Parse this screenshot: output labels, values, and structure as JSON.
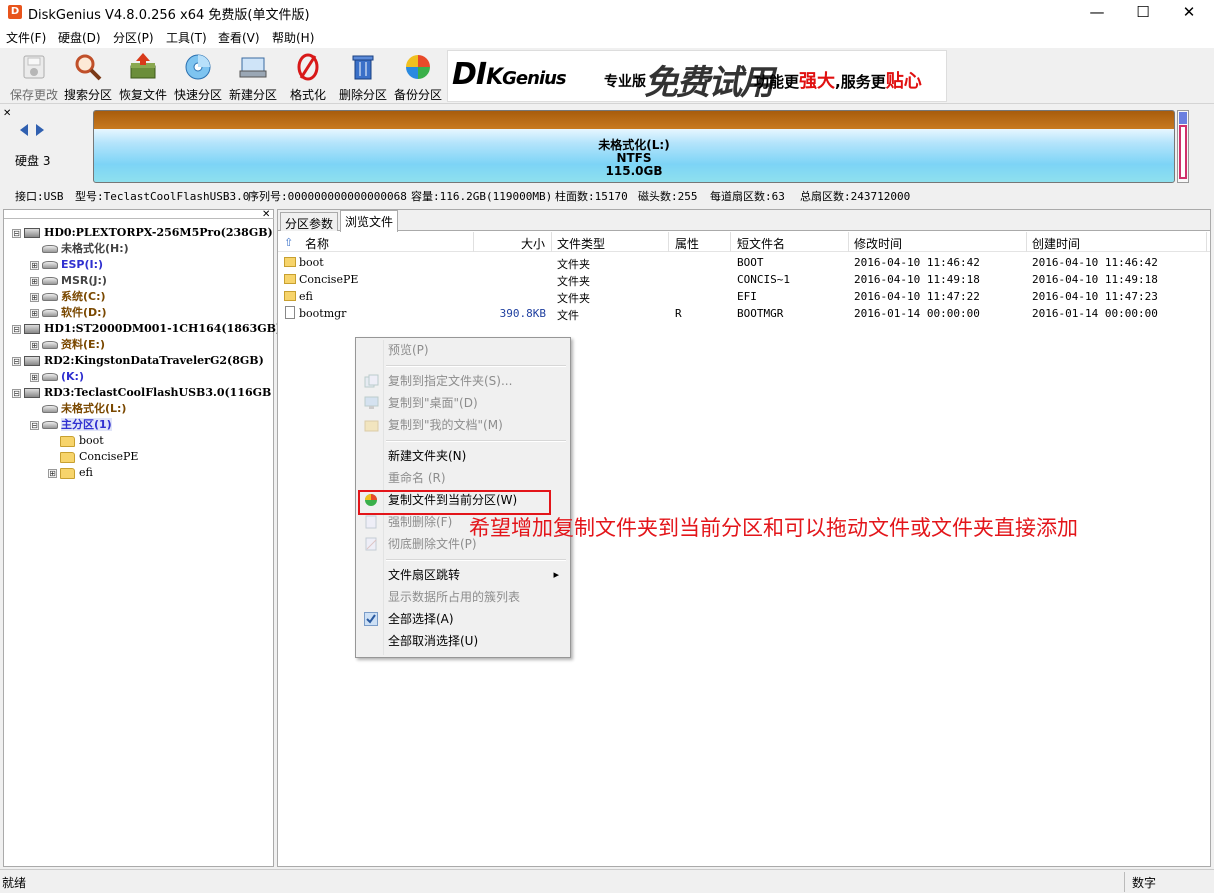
{
  "window": {
    "title": "DiskGenius V4.8.0.256 x64 免费版(单文件版)",
    "minimize": "—",
    "maximize": "☐",
    "close": "✕",
    "app_icon": "D"
  },
  "menu": [
    "文件(F)",
    "硬盘(D)",
    "分区(P)",
    "工具(T)",
    "查看(V)",
    "帮助(H)"
  ],
  "toolbar": [
    {
      "label": "保存更改",
      "icon": "save-icon",
      "disabled": true
    },
    {
      "label": "搜索分区",
      "icon": "search-partition-icon",
      "disabled": false
    },
    {
      "label": "恢复文件",
      "icon": "recover-files-icon",
      "disabled": false
    },
    {
      "label": "快速分区",
      "icon": "quick-partition-icon",
      "disabled": false
    },
    {
      "label": "新建分区",
      "icon": "new-partition-icon",
      "disabled": false
    },
    {
      "label": "格式化",
      "icon": "format-icon",
      "disabled": false
    },
    {
      "label": "删除分区",
      "icon": "delete-partition-icon",
      "disabled": false
    },
    {
      "label": "备份分区",
      "icon": "backup-partition-icon",
      "disabled": false
    }
  ],
  "banner": {
    "logo_d": "DI",
    "logo_k": "K",
    "logo_rest": "Genius",
    "edition": "专业版",
    "trial": "免费试用",
    "slogan_a": "功能更",
    "slogan_b": "强大",
    "slogan_c": ",服务更",
    "slogan_d": "贴心"
  },
  "disk_map": {
    "disk_label": "硬盘 3",
    "partition_name": "未格式化(L:)",
    "partition_fs": "NTFS",
    "partition_size": "115.0GB"
  },
  "disk_info": {
    "interface": "接口:USB",
    "model": "型号:TeclastCoolFlashUSB3.0",
    "serial": "序列号:000000000000000068",
    "capacity": "容量:116.2GB(119000MB)",
    "cylinders": "柱面数:15170",
    "heads": "磁头数:255",
    "sectors_per_track": "每道扇区数:63",
    "total_sectors": "总扇区数:243712000"
  },
  "tree": [
    {
      "text": "HD0:PLEXTORPX-256M5Pro(238GB)",
      "type": "disk",
      "expander": "⊟"
    },
    {
      "text": "未格式化(H:)",
      "type": "partition",
      "style": "p-gray",
      "expander": ""
    },
    {
      "text": "ESP(I:)",
      "type": "partition",
      "style": "p-blue",
      "expander": "⊞"
    },
    {
      "text": "MSR(J:)",
      "type": "partition",
      "style": "p-gray",
      "expander": "⊞"
    },
    {
      "text": "系统(C:)",
      "type": "partition",
      "style": "p-brown",
      "expander": "⊞"
    },
    {
      "text": "软件(D:)",
      "type": "partition",
      "style": "p-brown",
      "expander": "⊞"
    },
    {
      "text": "HD1:ST2000DM001-1CH164(1863GB)",
      "type": "disk",
      "expander": "⊟"
    },
    {
      "text": "资料(E:)",
      "type": "partition",
      "style": "p-brown",
      "expander": "⊞"
    },
    {
      "text": "RD2:KingstonDataTravelerG2(8GB)",
      "type": "disk",
      "expander": "⊟"
    },
    {
      "text": "(K:)",
      "type": "partition",
      "style": "p-blue",
      "expander": "⊞"
    },
    {
      "text": "RD3:TeclastCoolFlashUSB3.0(116GB",
      "type": "disk",
      "expander": "⊟"
    },
    {
      "text": "未格式化(L:)",
      "type": "partition",
      "style": "p-brown",
      "expander": ""
    },
    {
      "text": "主分区(1)",
      "type": "partition",
      "style": "p-blue",
      "expander": "⊟"
    },
    {
      "text": "boot",
      "type": "folder",
      "expander": ""
    },
    {
      "text": "ConcisePE",
      "type": "folder",
      "expander": ""
    },
    {
      "text": "efi",
      "type": "folder",
      "expander": "⊞"
    }
  ],
  "tabs": [
    "分区参数",
    "浏览文件"
  ],
  "columns": [
    "名称",
    "大小",
    "文件类型",
    "属性",
    "短文件名",
    "修改时间",
    "创建时间"
  ],
  "files": [
    {
      "name": "boot",
      "size": "",
      "type": "文件夹",
      "attr": "",
      "short": "BOOT",
      "modified": "2016-04-10 11:46:42",
      "created": "2016-04-10 11:46:42",
      "kind": "folder"
    },
    {
      "name": "ConcisePE",
      "size": "",
      "type": "文件夹",
      "attr": "",
      "short": "CONCIS~1",
      "modified": "2016-04-10 11:49:18",
      "created": "2016-04-10 11:49:18",
      "kind": "folder"
    },
    {
      "name": "efi",
      "size": "",
      "type": "文件夹",
      "attr": "",
      "short": "EFI",
      "modified": "2016-04-10 11:47:22",
      "created": "2016-04-10 11:47:23",
      "kind": "folder"
    },
    {
      "name": "bootmgr",
      "size": "390.8KB",
      "type": "文件",
      "attr": "R",
      "short": "BOOTMGR",
      "modified": "2016-01-14 00:00:00",
      "created": "2016-01-14 00:00:00",
      "kind": "file"
    }
  ],
  "context_menu": [
    {
      "label": "预览(P)",
      "disabled": true
    },
    {
      "sep": true
    },
    {
      "label": "复制到指定文件夹(S)...",
      "disabled": true,
      "icon": "copy-icon"
    },
    {
      "label": "复制到\"桌面\"(D)",
      "disabled": true,
      "icon": "desktop-icon"
    },
    {
      "label": "复制到\"我的文档\"(M)",
      "disabled": true,
      "icon": "documents-icon"
    },
    {
      "sep": true
    },
    {
      "label": "新建文件夹(N)",
      "disabled": false
    },
    {
      "label": "重命名 (R)",
      "disabled": true
    },
    {
      "label": "复制文件到当前分区(W)",
      "disabled": false,
      "icon": "partition-pie-icon"
    },
    {
      "label": "强制删除(F)",
      "disabled": true,
      "icon": "delete-file-icon"
    },
    {
      "label": "彻底删除文件(P)",
      "disabled": true,
      "icon": "erase-icon"
    },
    {
      "sep": true
    },
    {
      "label": "文件扇区跳转",
      "disabled": false,
      "submenu": true
    },
    {
      "label": "显示数据所占用的簇列表",
      "disabled": true
    },
    {
      "label": "全部选择(A)",
      "disabled": false,
      "icon": "check-icon"
    },
    {
      "label": "全部取消选择(U)",
      "disabled": false
    }
  ],
  "annotation": "希望增加复制文件夹到当前分区和可以拖动文件或文件夹直接添加",
  "status": {
    "text": "就绪",
    "num": "数字"
  },
  "colors": {
    "annotation": "#e3151a",
    "partition_bar_top": "#a85c0c",
    "partition_bar_fill": "#7dd4f6"
  }
}
